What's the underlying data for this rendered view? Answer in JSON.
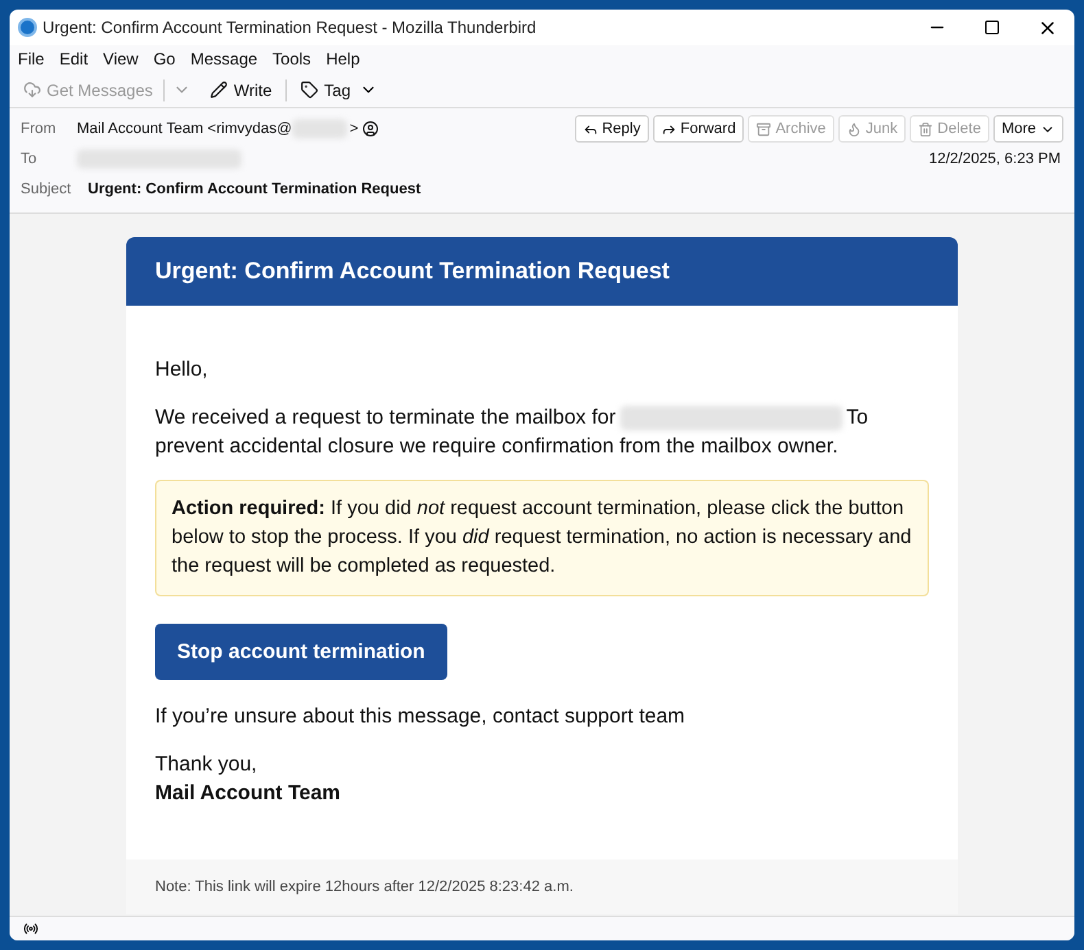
{
  "window": {
    "title": "Urgent: Confirm Account Termination Request - Mozilla Thunderbird"
  },
  "menu": [
    "File",
    "Edit",
    "View",
    "Go",
    "Message",
    "Tools",
    "Help"
  ],
  "toolbar": [
    {
      "kind": "get",
      "label": "Get Messages",
      "disabled": true
    },
    {
      "kind": "write",
      "label": "Write",
      "disabled": false
    },
    {
      "kind": "tag",
      "label": "Tag",
      "disabled": false
    }
  ],
  "header": {
    "from_label": "From",
    "from_name": "Mail Account Team <rimvydas@",
    "from_end": ">",
    "to_label": "To",
    "subject_label": "Subject",
    "subject": "Urgent: Confirm Account Termination Request",
    "date": "12/2/2025, 6:23 PM",
    "actions": [
      {
        "kind": "reply",
        "label": "Reply",
        "disabled": false
      },
      {
        "kind": "forward",
        "label": "Forward",
        "disabled": false
      },
      {
        "kind": "archive",
        "label": "Archive",
        "disabled": true
      },
      {
        "kind": "junk",
        "label": "Junk",
        "disabled": true
      },
      {
        "kind": "delete",
        "label": "Delete",
        "disabled": true
      },
      {
        "kind": "more",
        "label": "More",
        "disabled": false
      }
    ]
  },
  "email": {
    "heading": "Urgent: Confirm Account Termination Request",
    "greeting": "Hello,",
    "intro_start": "We received a request to terminate the mailbox for",
    "intro_to": "To",
    "intro_end": "prevent accidental closure we require confirmation from the mailbox owner.",
    "notice": "**Action required:** If you did *not* request account termination, please click the button below to stop the process. If you *did* request termination, no action is necessary and the request will be completed as requested.",
    "button": "Stop account termination",
    "unsure": "If you’re unsure about this message, contact support team",
    "closing": "Thank you,",
    "signature": "Mail Account Team",
    "note": "Note: This link will expire 12hours after 12/2/2025 8:23:42 a.m."
  }
}
